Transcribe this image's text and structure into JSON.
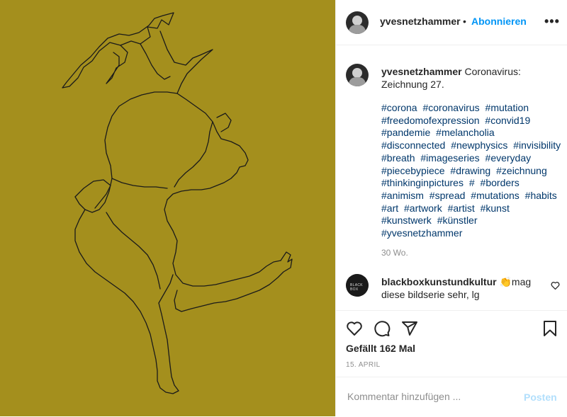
{
  "post": {
    "image_alt_color": "#a48f1d",
    "author": "yvesnetzhammer",
    "follow_label": "Abonnieren",
    "header_separator": "•",
    "more_label": "•••"
  },
  "caption": {
    "author": "yvesnetzhammer",
    "text": "Coronavirus: Zeichnung 27.",
    "hashtags": [
      "#corona",
      "#coronavirus",
      "#mutation",
      "#freedomofexpression",
      "#convid19",
      "#pandemie",
      "#melancholia",
      "#disconnected",
      "#newphysics",
      "#invisibility",
      "#breath",
      "#imageseries",
      "#everyday",
      "#piecebypiece",
      "#drawing",
      "#zeichnung",
      "#thinkinginpictures",
      "#",
      "#borders",
      "#animism",
      "#spread",
      "#mutations",
      "#habits",
      "#art",
      "#artwork",
      "#artist",
      "#kunst",
      "#kunstwerk",
      "#künstler",
      "#yvesnetzhammer"
    ],
    "age": "30 Wo."
  },
  "comment": {
    "author": "blackboxkunstundkultur",
    "emoji": "👏",
    "text": "mag diese bildserie sehr, lg",
    "avatar_text": "BLACK BOX"
  },
  "stats": {
    "likes": "Gefällt 162 Mal",
    "date": "15. APRIL"
  },
  "composer": {
    "placeholder": "Kommentar hinzufügen ...",
    "post_label": "Posten"
  },
  "icons": [
    "heart-icon",
    "comment-icon",
    "share-icon",
    "bookmark-icon",
    "small-heart-icon"
  ]
}
